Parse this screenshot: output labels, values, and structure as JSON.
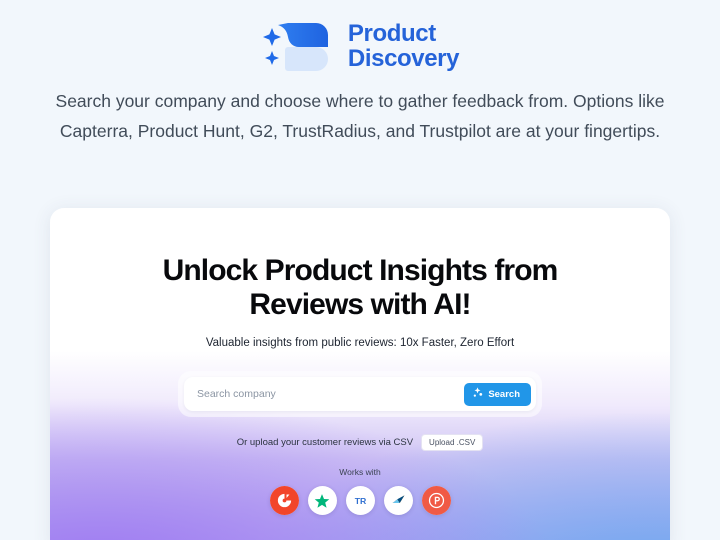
{
  "brand": {
    "mark_icon": "sparkle-d-logo-icon",
    "name_line1": "Product",
    "name_line2": "Discovery",
    "color": "#2563d9"
  },
  "intro": {
    "line1": "Search your company and choose where to gather feedback from. Options like",
    "line2": "Capterra, Product Hunt, G2, TrustRadius, and Trustpilot are at your fingertips."
  },
  "hero": {
    "title_line1": "Unlock Product Insights from",
    "title_line2": "Reviews with AI!",
    "subtitle": "Valuable insights from public reviews: 10x Faster, Zero Effort"
  },
  "search": {
    "placeholder": "Search company",
    "value": "",
    "button_label": "Search",
    "button_icon": "ai-sparkle-icon",
    "button_color": "#2196e8"
  },
  "csv": {
    "label": "Or upload your customer reviews via CSV",
    "button_label": "Upload .CSV"
  },
  "works_with": {
    "label": "Works with",
    "logos": [
      {
        "name": "g2-logo-icon",
        "glyph": "G",
        "bg": "#f2452a",
        "fg": "#ffffff"
      },
      {
        "name": "trustpilot-logo-icon",
        "glyph": "★",
        "bg": "#ffffff",
        "fg": "#00b67a"
      },
      {
        "name": "trustradius-logo-icon",
        "glyph": "TR",
        "bg": "#ffffff",
        "fg": "#2f6fd0"
      },
      {
        "name": "capterra-logo-icon",
        "glyph": "➤",
        "bg": "#ffffff",
        "fg": "#ff9d28"
      },
      {
        "name": "product-hunt-logo-icon",
        "glyph": "P",
        "bg": "#f05a45",
        "fg": "#ffffff"
      }
    ]
  }
}
